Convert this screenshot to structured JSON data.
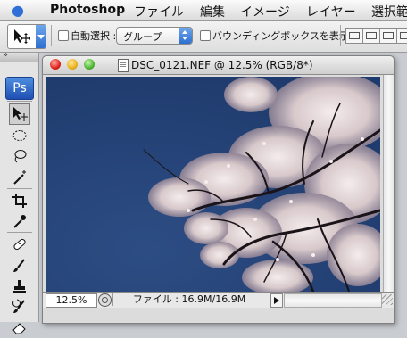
{
  "menubar": {
    "app_name": "Photoshop",
    "items": [
      "ファイル",
      "編集",
      "イメージ",
      "レイヤー",
      "選択範"
    ]
  },
  "options": {
    "auto_select_label": "自動選択 :",
    "auto_select_value": "グループ",
    "bounding_box_label": "バウンディングボックスを表示"
  },
  "toolbox": {
    "logo": "Ps",
    "tools": [
      "move-tool-icon",
      "elliptical-marquee-icon",
      "lasso-icon",
      "magic-wand-icon",
      "crop-icon",
      "eyedropper-icon",
      "healing-brush-icon",
      "brush-icon",
      "clone-stamp-icon",
      "history-brush-icon",
      "eraser-icon"
    ]
  },
  "document": {
    "title": "DSC_0121.NEF @ 12.5% (RGB/8*)",
    "zoom": "12.5%",
    "status": "ファイル : 16.9M/16.9M"
  },
  "colors": {
    "sky": "#2d4f86",
    "blossom": "#e9dede",
    "accent": "#2d6fd0"
  }
}
